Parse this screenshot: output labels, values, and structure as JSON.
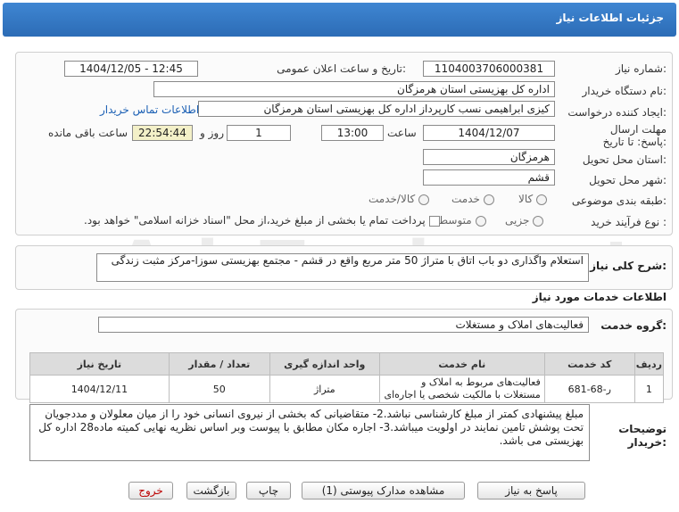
{
  "header": {
    "title": "جزئیات اطلاعات نیاز"
  },
  "fields": {
    "need_number_label": "شماره نیاز:",
    "need_number": "1104003706000381",
    "announce_label": "تاریخ و ساعت اعلان عمومی:",
    "announce_value": "1404/12/05 - 12:45",
    "buyer_org_label": "نام دستگاه خریدار:",
    "buyer_org": "اداره کل بهزیستی استان هرمزگان",
    "creator_label": "ایجاد کننده درخواست:",
    "creator": "کیزی  ابراهیمی نسب کارپرداز اداره کل بهزیستی استان هرمزگان",
    "contact_link": "اطلاعات تماس خریدار",
    "deadline_label": "مهلت ارسال پاسخ: تا تاریخ:",
    "deadline_date": "1404/12/07",
    "time_label": "ساعت",
    "deadline_time": "13:00",
    "days_value": "1",
    "days_label": "روز و",
    "remaining_time": "22:54:44",
    "remaining_label": "ساعت باقی مانده",
    "province_label": "استان محل تحویل:",
    "province": "هرمزگان",
    "city_label": "شهر محل تحویل:",
    "city": "قشم",
    "category_label": "طبقه بندی موضوعی:",
    "category_options": [
      "کالا",
      "خدمت",
      "کالا/خدمت"
    ],
    "process_label": "نوع فرآیند خرید :",
    "process_options": [
      "جزیی",
      "متوسط"
    ],
    "payment_note": "پرداخت تمام یا بخشی از مبلغ خرید،از محل \"اسناد خزانه اسلامی\" خواهد بود."
  },
  "summary": {
    "label": "شرح کلی نیاز:",
    "text": "استعلام واگذاری دو باب اتاق با متراژ 50 متر مربع واقع در قشم - مجتمع بهزیستی سوزا-مرکز مثبت زندگی"
  },
  "services": {
    "section_title": "اطلاعات خدمات مورد نیاز",
    "group_label": "گروه خدمت:",
    "group_value": "فعالیت‌های  املاک و مستغلات"
  },
  "table": {
    "headers": [
      "ردیف",
      "کد خدمت",
      "نام خدمت",
      "واحد اندازه گیری",
      "تعداد / مقدار",
      "تاریخ نیاز"
    ],
    "rows": [
      [
        "1",
        "ر-68-681",
        "فعالیت‌های مربوط به املاک و مستغلات با مالکیت شخصی یا اجاره‌ای",
        "متراژ",
        "50",
        "1404/12/11"
      ]
    ]
  },
  "buyer_notes": {
    "label": "توضیحات خریدار:",
    "text": "مبلغ پیشنهادی کمتر از مبلغ کارشناسی نباشد.2- متقاضیانی که بخشی از نیروی انسانی خود را از میان معلولان و مددجویان تحت پوشش تامین نمایند در اولویت میباشد.3-  اجاره مکان  مطابق با پیوست وبر اساس نظریه نهایی کمیته ماده28 اداره کل بهزیستی می باشد."
  },
  "buttons": {
    "reply": "پاسخ به نیاز",
    "attachments": "مشاهده مدارک پیوستی (1)",
    "print": "چاپ",
    "back": "بازگشت",
    "exit": "خروج"
  },
  "watermark": "AriaTender.net",
  "colors": {
    "header": "#2c6cb6",
    "link": "#1a5fb4",
    "remaining_bg": "#f3f0c8"
  }
}
